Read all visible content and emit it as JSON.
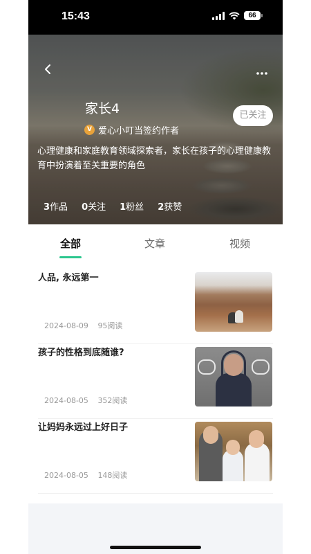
{
  "status_bar": {
    "time": "15:43",
    "battery": "66"
  },
  "profile": {
    "name": "家长4",
    "badge_letter": "V",
    "badge_text": "爱心小叮当签约作者",
    "follow_label": "已关注",
    "bio": "心理健康和家庭教育领域探索者，家长在孩子的心理健康教育中扮演着至关重要的角色",
    "stats": [
      {
        "count": "3",
        "label": "作品"
      },
      {
        "count": "0",
        "label": "关注"
      },
      {
        "count": "1",
        "label": "粉丝"
      },
      {
        "count": "2",
        "label": "获赞"
      }
    ]
  },
  "tabs": [
    {
      "label": "全部",
      "active": true
    },
    {
      "label": "文章",
      "active": false
    },
    {
      "label": "视频",
      "active": false
    }
  ],
  "articles": [
    {
      "title": "人品, 永远第一",
      "date": "2024-08-09",
      "reads": "95阅读"
    },
    {
      "title": "孩子的性格到底随谁?",
      "date": "2024-08-05",
      "reads": "352阅读"
    },
    {
      "title": "让妈妈永远过上好日子",
      "date": "2024-08-05",
      "reads": "148阅读"
    }
  ],
  "colors": {
    "accent": "#2cc68e",
    "badge": "#e8a23a"
  }
}
